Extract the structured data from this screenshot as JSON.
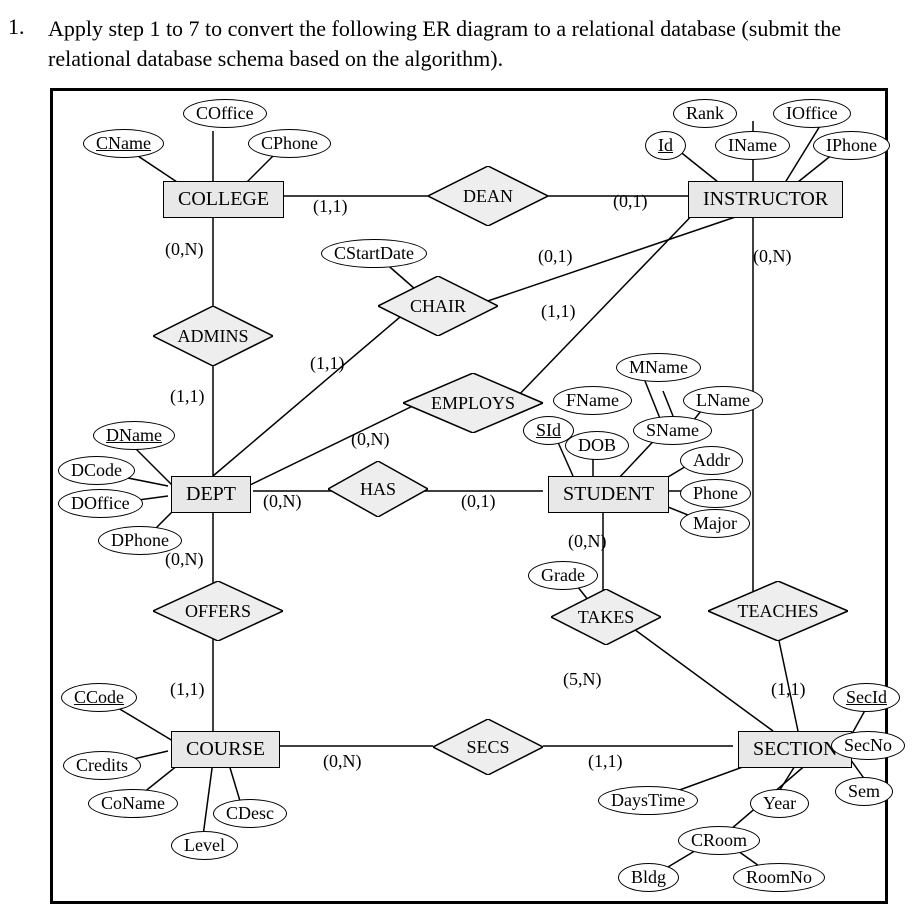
{
  "question": {
    "number": "1.",
    "text": "Apply step 1 to 7 to convert the following ER diagram to a relational database (submit the relational database schema based on the algorithm)."
  },
  "entities": {
    "college": "COLLEGE",
    "instructor": "INSTRUCTOR",
    "dept": "DEPT",
    "student": "STUDENT",
    "course": "COURSE",
    "section": "SECTION"
  },
  "relationships": {
    "dean": "DEAN",
    "admins": "ADMINS",
    "chair": "CHAIR",
    "employs": "EMPLOYS",
    "has": "HAS",
    "offers": "OFFERS",
    "takes": "TAKES",
    "teaches": "TEACHES",
    "secs": "SECS"
  },
  "attributes": {
    "coffice": "COffice",
    "cname": "CName",
    "cphone": "CPhone",
    "rank": "Rank",
    "ioffice": "IOffice",
    "id": "Id",
    "iname": "IName",
    "iphone": "IPhone",
    "cstartdate": "CStartDate",
    "dname": "DName",
    "dcode": "DCode",
    "doffice": "DOffice",
    "dphone": "DPhone",
    "mname": "MName",
    "fname": "FName",
    "lname": "LName",
    "sid": "SId",
    "sname": "SName",
    "dob": "DOB",
    "addr": "Addr",
    "phone": "Phone",
    "major": "Major",
    "grade": "Grade",
    "ccode": "CCode",
    "credits": "Credits",
    "coname": "CoName",
    "cdesc": "CDesc",
    "level": "Level",
    "daystime": "DaysTime",
    "year": "Year",
    "sem": "Sem",
    "secid": "SecId",
    "secno": "SecNo",
    "croom": "CRoom",
    "bldg": "Bldg",
    "roomno": "RoomNo"
  },
  "cardinalities": {
    "dean_col": "(1,1)",
    "dean_inst": "(0,1)",
    "admins_col": "(0,N)",
    "admins_dept": "(1,1)",
    "chair_dept": "(1,1)",
    "chair_inst": "(0,1)",
    "employs_dept": "(0,N)",
    "employs_inst": "(1,1)",
    "has_dept": "(0,N)",
    "has_student": "(0,1)",
    "offers_dept": "(0,N)",
    "offers_course": "(1,1)",
    "takes_student": "(0,N)",
    "takes_section": "(5,N)",
    "teaches_inst": "(0,N)",
    "teaches_section": "(1,1)",
    "secs_course": "(0,N)",
    "secs_section": "(1,1)"
  }
}
